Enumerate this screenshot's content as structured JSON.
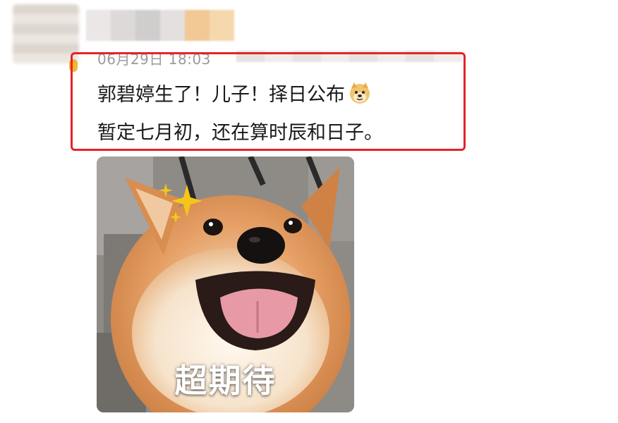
{
  "post": {
    "timestamp": "06月29日 18:03",
    "line1": "郭碧婷生了！儿子！择日公布",
    "line2": "暂定七月初，还在算时辰和日子。",
    "emoji_icon": "doge-emoji-icon"
  },
  "image": {
    "caption": "超期待",
    "subject": "shiba-inu-smiling-dog",
    "sparkle_icon": "sparkle-icon"
  },
  "colors": {
    "highlight_border": "#e4232a",
    "timestamp_text": "#9a9a9a",
    "post_text": "#1a1a1a"
  }
}
